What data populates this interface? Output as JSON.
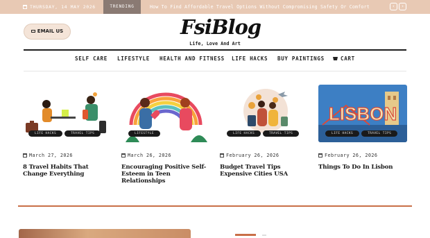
{
  "topbar": {
    "date": "THURSDAY, 14 MAY 2026",
    "trending_label": "TRENDING",
    "ticker_text": "How To Find Affordable Travel Options Without Compromising Safety Or Comfort",
    "prev": "‹",
    "next": "›"
  },
  "header": {
    "email_label": "EMAIL US",
    "logo": "FsiBlog",
    "tagline": "Life, Love And Art"
  },
  "nav": {
    "items": [
      "SELF CARE",
      "LIFESTYLE",
      "HEALTH AND FITNESS",
      "LIFE HACKS",
      "BUY PAINTINGS"
    ],
    "cart": "CART"
  },
  "posts": [
    {
      "date": "March 27, 2026",
      "title": "8 Travel Habits That Change Everything",
      "tags": [
        "LIFE HACKS",
        "TRAVEL TIPS"
      ]
    },
    {
      "date": "March 26, 2026",
      "title": "Encouraging Positive Self-Esteem in Teen Relationships",
      "tags": [
        "LIFESTYLE"
      ]
    },
    {
      "date": "February 26, 2026",
      "title": "Budget Travel Tips Expensive Cities USA",
      "tags": [
        "LIFE HACKS",
        "TRAVEL TIPS"
      ]
    },
    {
      "date": "February 26, 2026",
      "title": "Things To Do In Lisbon",
      "tags": [
        "LIFE HACKS",
        "TRAVEL TIPS"
      ],
      "image_text": "LISBON"
    }
  ],
  "colors": {
    "topbar": "#e8c9b4",
    "trending": "#8a7a73",
    "accent": "#c96f47",
    "email_button": "#f4e4d8"
  }
}
